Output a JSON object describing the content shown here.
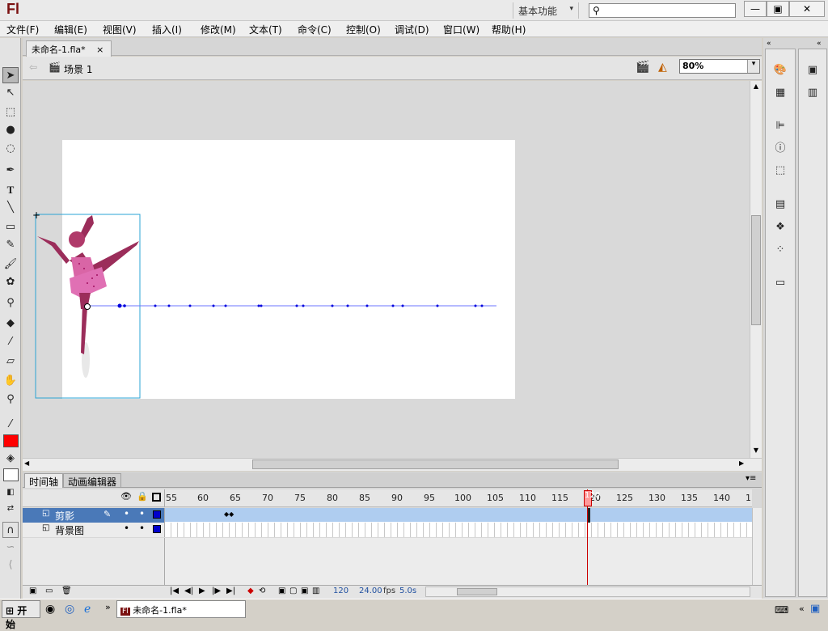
{
  "app": {
    "logo": "Fl",
    "workspace": "基本功能",
    "search_placeholder": ""
  },
  "window_buttons": [
    "—",
    "▣",
    "✕"
  ],
  "menu": [
    "文件(F)",
    "编辑(E)",
    "视图(V)",
    "插入(I)",
    "修改(M)",
    "文本(T)",
    "命令(C)",
    "控制(O)",
    "调试(D)",
    "窗口(W)",
    "帮助(H)"
  ],
  "document": {
    "tab": "未命名-1.fla*",
    "close": "×",
    "scene": "场景 1",
    "zoom": "80%"
  },
  "timeline": {
    "tabs": [
      "时间轴",
      "动画编辑器"
    ],
    "ruler": [
      "55",
      "60",
      "65",
      "70",
      "75",
      "80",
      "85",
      "90",
      "95",
      "100",
      "105",
      "110",
      "115",
      "120",
      "125",
      "130",
      "135",
      "140",
      "1"
    ],
    "playhead_label": "120",
    "layers": [
      {
        "name": "剪影",
        "selected": true
      },
      {
        "name": "背景图",
        "selected": false
      }
    ],
    "footer": {
      "frame": "120",
      "fps": "24.00",
      "fps_unit": "fps",
      "time": "5.0s"
    }
  },
  "taskbar": {
    "start": "开始",
    "app_label": "未命名-1.fla*"
  },
  "colors": {
    "stroke": "#ff0000",
    "layer_selected": "#afcdf0",
    "layer_swatch": "#0000cc",
    "playhead": "#cc0000",
    "figure": "#9b2d5a"
  },
  "icons": [
    "arrow-icon",
    "subselect-icon",
    "free-transform-icon",
    "3d-rotate-icon",
    "lasso-icon",
    "pen-icon",
    "text-icon",
    "line-icon",
    "rectangle-icon",
    "pencil-icon",
    "brush-icon",
    "deco-icon",
    "bone-icon",
    "paint-bucket-icon",
    "eyedropper-icon",
    "eraser-icon",
    "hand-icon",
    "zoom-icon"
  ]
}
